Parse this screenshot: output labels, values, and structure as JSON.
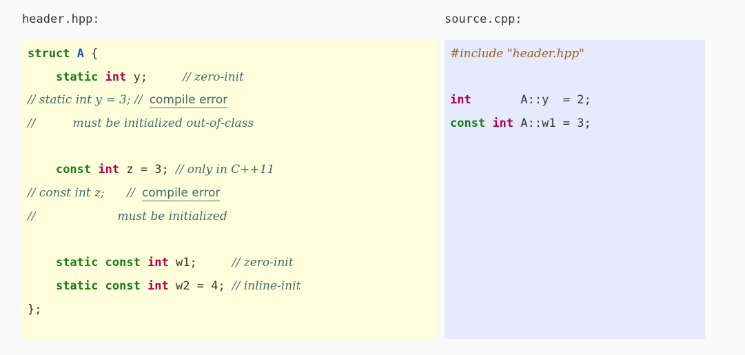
{
  "labels": {
    "header": "header.hpp:",
    "source": "source.cpp:"
  },
  "header_code": {
    "l1": {
      "kw": "struct",
      "cls": "A",
      "rest": " {"
    },
    "l2": {
      "kw": "static",
      "ty": "int",
      "rest": " y;",
      "cm": "// zero-init"
    },
    "l3": {
      "cm": "// static int y = 3; //",
      "cm_u": "compile error"
    },
    "l4": {
      "cm": "//          must be initialized out-of-class"
    },
    "l5": {},
    "l6": {
      "kw": "const",
      "ty": "int",
      "rest": " z = 3;",
      "cm": "// only in C++11"
    },
    "l7": {
      "cm": "// const int z;      //",
      "cm_u": "compile error"
    },
    "l8": {
      "cm": "//                      must be initialized"
    },
    "l9": {},
    "l10": {
      "kw1": "static",
      "kw2": "const",
      "ty": "int",
      "rest": " w1;",
      "cm": "// zero-init"
    },
    "l11": {
      "kw1": "static",
      "kw2": "const",
      "ty": "int",
      "rest": " w2 = 4;",
      "cm": "// inline-init"
    },
    "l12": {
      "rest": "};"
    }
  },
  "source_code": {
    "l1": {
      "pp": "#include \"header.hpp\""
    },
    "l2": {},
    "l3": {
      "ty": "int",
      "rest": "       A::y  = 2;"
    },
    "l4": {
      "kw": "const",
      "ty": "int",
      "rest": " A::w1 = 3;"
    }
  }
}
